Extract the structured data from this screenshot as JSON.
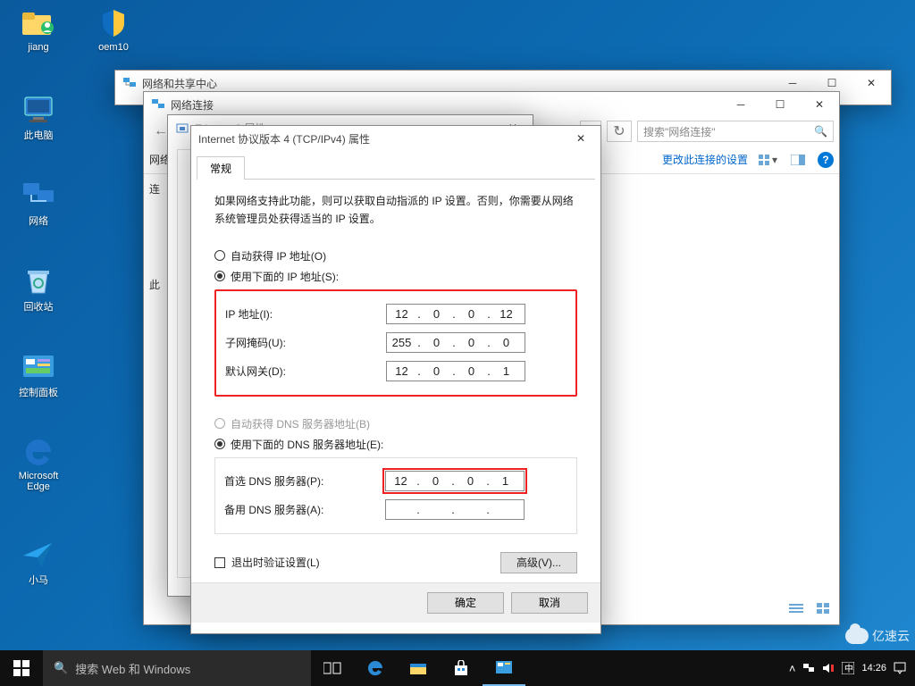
{
  "desktop": {
    "icons": [
      {
        "label": "jiang"
      },
      {
        "label": "oem10"
      },
      {
        "label": "此电脑"
      },
      {
        "label": "网络"
      },
      {
        "label": "回收站"
      },
      {
        "label": "控制面板"
      },
      {
        "label": "Microsoft Edge"
      },
      {
        "label": "小马"
      }
    ]
  },
  "win_share": {
    "title": "网络和共享中心"
  },
  "win_connections": {
    "title": "网络连接",
    "search_placeholder": "搜索\"网络连接\"",
    "toolbar_link": "更改此连接的设置",
    "left_frag_top": "网络",
    "left_frag_mid": "连",
    "left_frag_bot": "此"
  },
  "win_eth": {
    "title": "Ethernet0 属性"
  },
  "dlg": {
    "title": "Internet 协议版本 4 (TCP/IPv4) 属性",
    "tab": "常规",
    "desc": "如果网络支持此功能，则可以获取自动指派的 IP 设置。否则，你需要从网络系统管理员处获得适当的 IP 设置。",
    "radio_auto_ip": "自动获得 IP 地址(O)",
    "radio_static_ip": "使用下面的 IP 地址(S):",
    "lbl_ip": "IP 地址(I):",
    "lbl_mask": "子网掩码(U):",
    "lbl_gateway": "默认网关(D):",
    "ip": [
      "12",
      "0",
      "0",
      "12"
    ],
    "mask": [
      "255",
      "0",
      "0",
      "0"
    ],
    "gateway": [
      "12",
      "0",
      "0",
      "1"
    ],
    "radio_auto_dns": "自动获得 DNS 服务器地址(B)",
    "radio_static_dns": "使用下面的 DNS 服务器地址(E):",
    "lbl_dns1": "首选 DNS 服务器(P):",
    "lbl_dns2": "备用 DNS 服务器(A):",
    "dns1": [
      "12",
      "0",
      "0",
      "1"
    ],
    "dns2": [
      "",
      "",
      "",
      ""
    ],
    "chk_validate": "退出时验证设置(L)",
    "btn_advanced": "高级(V)...",
    "btn_ok": "确定",
    "btn_cancel": "取消"
  },
  "taskbar": {
    "search": "搜索 Web 和 Windows",
    "clock": "14:26"
  },
  "watermark": "亿速云"
}
